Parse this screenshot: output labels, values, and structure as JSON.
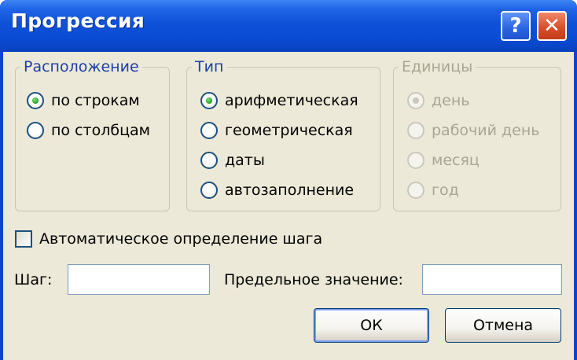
{
  "window": {
    "title": "Прогрессия",
    "help_glyph": "?",
    "close_glyph": "✕"
  },
  "location": {
    "legend": "Расположение",
    "options": [
      {
        "label": "по строкам",
        "selected": true
      },
      {
        "label": "по столбцам",
        "selected": false
      }
    ]
  },
  "type": {
    "legend": "Тип",
    "options": [
      {
        "label": "арифметическая",
        "selected": true
      },
      {
        "label": "геометрическая",
        "selected": false
      },
      {
        "label": "даты",
        "selected": false
      },
      {
        "label": "автозаполнение",
        "selected": false
      }
    ]
  },
  "units": {
    "legend": "Единицы",
    "enabled": false,
    "options": [
      {
        "label": "день",
        "selected": true
      },
      {
        "label": "рабочий день",
        "selected": false
      },
      {
        "label": "месяц",
        "selected": false
      },
      {
        "label": "год",
        "selected": false
      }
    ]
  },
  "auto_step": {
    "label": "Автоматическое определение шага",
    "checked": false
  },
  "step": {
    "label": "Шаг:",
    "value": ""
  },
  "limit": {
    "label": "Предельное значение:",
    "value": ""
  },
  "buttons": {
    "ok": "ОК",
    "cancel": "Отмена"
  },
  "colors": {
    "titlebar": "#0a4bd4",
    "client_bg": "#ece9d8",
    "legend_text": "#1e3ea8",
    "disabled_text": "#a8a693",
    "radio_dot": "#21a121",
    "close_button": "#d8502c"
  }
}
